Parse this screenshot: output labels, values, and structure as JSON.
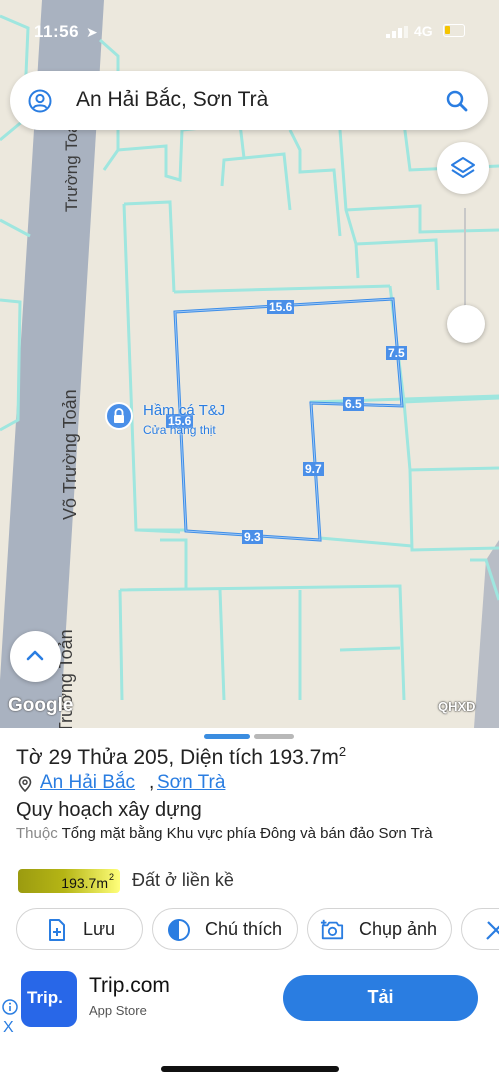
{
  "status": {
    "time": "11:56",
    "network": "4G"
  },
  "search": {
    "query": "An Hải Bắc, Sơn Trà"
  },
  "map": {
    "road_labels": [
      "Võ Trường Toản",
      "Võ Trường Toản",
      "Võ Trường Toản"
    ],
    "poi": {
      "name": "Hầm cá T&J",
      "category": "Cửa hàng thịt"
    },
    "dimensions": [
      "15.6",
      "7.5",
      "6.5",
      "9.7",
      "9.3",
      "15.6"
    ],
    "attribution": "Google",
    "overlay_label": "QHXD",
    "opacity_level": 1.0,
    "colors": {
      "road": "#a9b2c0",
      "parcel_border": "#3e8ee8",
      "parcel_lines": "#9fe6df",
      "land": "#ece8dd"
    }
  },
  "sheet": {
    "parcel": {
      "prefix": "Tờ ",
      "sheet_no": "29",
      "mid": " Thửa ",
      "plot_no": "205",
      "area_label": ", Diện tích 193.7m",
      "area_sup": "2"
    },
    "location": {
      "ward": "An Hải Bắc",
      "separator": ",",
      "district": "Sơn Trà"
    },
    "plan_title": "Quy hoạch xây dựng",
    "plan_prefix": "Thuộc",
    "plan_name": "Tổng mặt bằng Khu vực phía Đông và bán đảo Sơn Trà",
    "area_chip": {
      "value": "193.7m",
      "sup": "2"
    },
    "land_type": "Đất ở liền kề",
    "actions": [
      {
        "label": "Lưu",
        "icon": "add-file-icon"
      },
      {
        "label": "Chú thích",
        "icon": "half-circle-icon"
      },
      {
        "label": "Chụp ảnh",
        "icon": "camera-add-icon"
      }
    ]
  },
  "ad": {
    "logo_text": "Trip.",
    "title": "Trip.com",
    "subtitle": "App Store",
    "install_label": "Tải",
    "close_label": "X"
  }
}
